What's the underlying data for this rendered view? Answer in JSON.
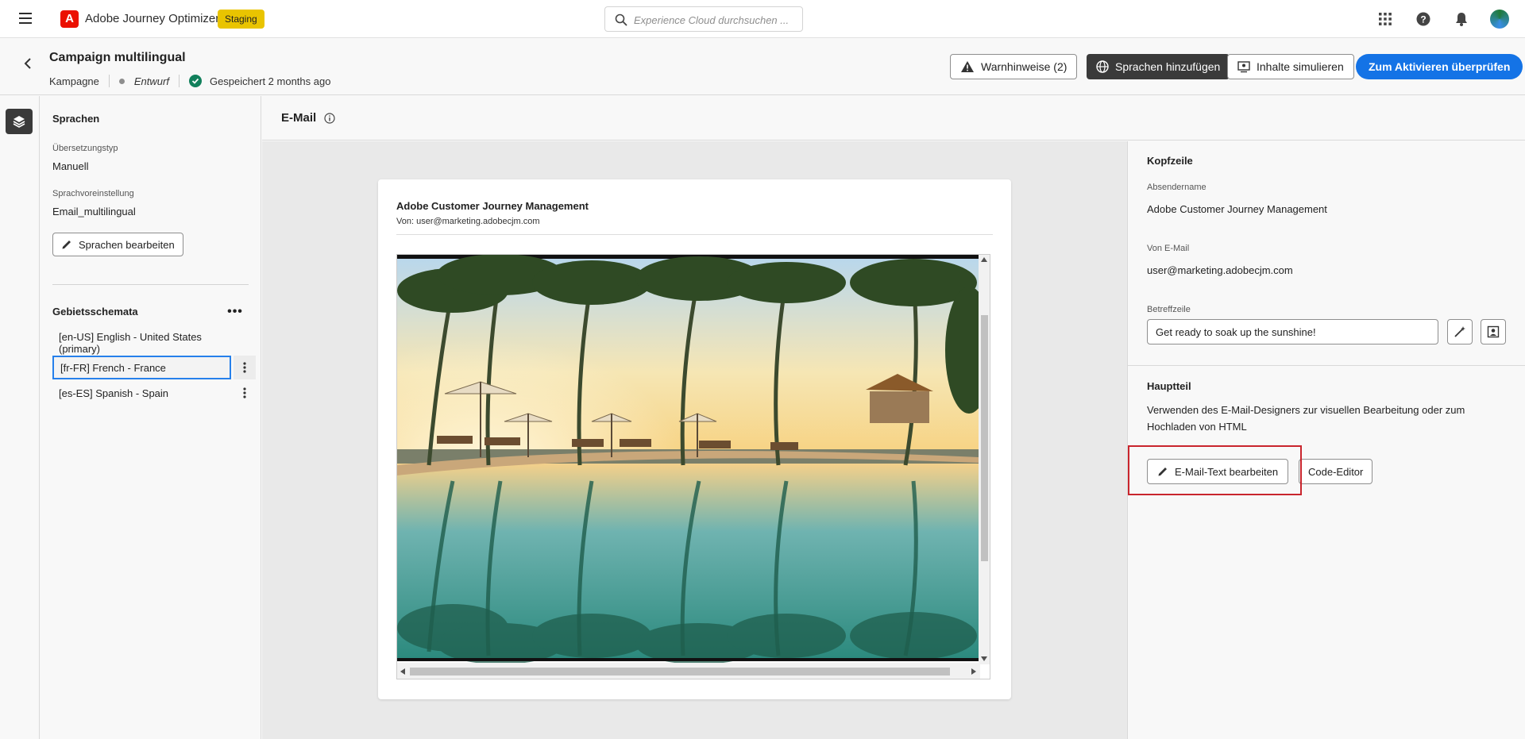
{
  "topbar": {
    "app_title": "Adobe Journey Optimizer",
    "env_badge": "Staging",
    "search_placeholder": "Experience Cloud durchsuchen ..."
  },
  "header": {
    "title": "Campaign multilingual",
    "type": "Kampagne",
    "status": "Entwurf",
    "saved": "Gespeichert 2 months ago",
    "buttons": {
      "warnings": "Warnhinweise (2)",
      "add_languages": "Sprachen hinzufügen",
      "simulate": "Inhalte simulieren",
      "review": "Zum Aktivieren überprüfen"
    }
  },
  "languages_panel": {
    "title": "Sprachen",
    "translation_type_label": "Übersetzungstyp",
    "translation_type_value": "Manuell",
    "preset_label": "Sprachvoreinstellung",
    "preset_value": "Email_multilingual",
    "edit_button": "Sprachen bearbeiten",
    "locales_title": "Gebietsschemata",
    "locales": [
      {
        "label": "[en-US] English - United States (primary)"
      },
      {
        "label": "[fr-FR] French - France"
      },
      {
        "label": "[es-ES] Spanish - Spain"
      }
    ]
  },
  "editor": {
    "title": "E-Mail",
    "preview": {
      "sender": "Adobe Customer Journey Management",
      "from": "Von: user@marketing.adobecjm.com"
    }
  },
  "right_panel": {
    "header_section": "Kopfzeile",
    "sender_name_label": "Absendername",
    "sender_name_value": "Adobe Customer Journey Management",
    "from_email_label": "Von E-Mail",
    "from_email_value": "user@marketing.adobecjm.com",
    "subject_label": "Betreffzeile",
    "subject_value": "Get ready to soak up the sunshine!",
    "body_section": "Hauptteil",
    "body_desc_line1": "Verwenden des E-Mail-Designers zur visuellen Bearbeitung oder zum",
    "body_desc_line2": "Hochladen von HTML",
    "edit_email_button": "E-Mail-Text bearbeiten",
    "code_editor_button": "Code-Editor"
  },
  "colors": {
    "primary": "#1473e6",
    "staging": "#e9c400",
    "highlight": "#c9252d",
    "brand": "#eb1000"
  }
}
